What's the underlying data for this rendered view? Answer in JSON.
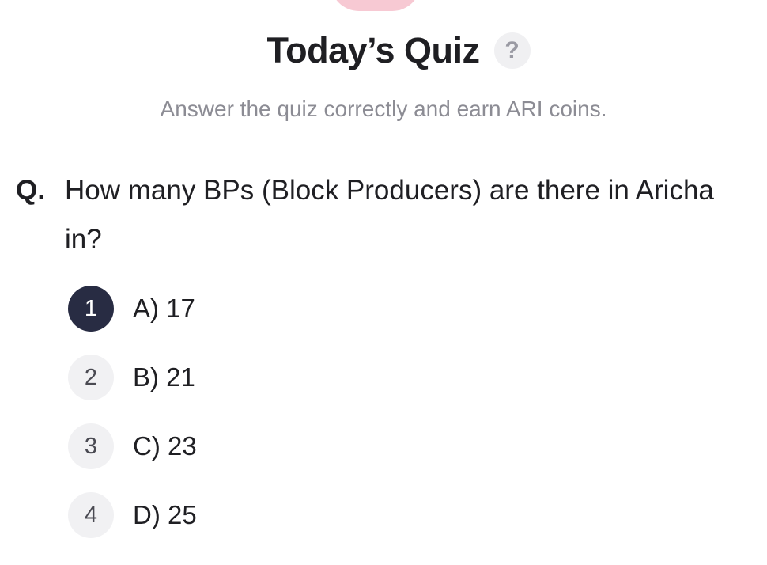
{
  "header": {
    "title": "Today’s Quiz",
    "help_symbol": "?"
  },
  "subtitle": "Answer the quiz correctly and earn ARI coins.",
  "question": {
    "prefix": "Q.",
    "text": "How many BPs (Block Producers) are there in Aricha in?"
  },
  "options": [
    {
      "number": "1",
      "label": "A) 17",
      "selected": true
    },
    {
      "number": "2",
      "label": "B) 21",
      "selected": false
    },
    {
      "number": "3",
      "label": "C) 23",
      "selected": false
    },
    {
      "number": "4",
      "label": "D) 25",
      "selected": false
    }
  ],
  "colors": {
    "selected_badge": "#282c43",
    "unselected_badge": "#f1f1f3",
    "accent_pink": "#f7c9d3"
  },
  "icons": {
    "help": "help-question-icon"
  }
}
